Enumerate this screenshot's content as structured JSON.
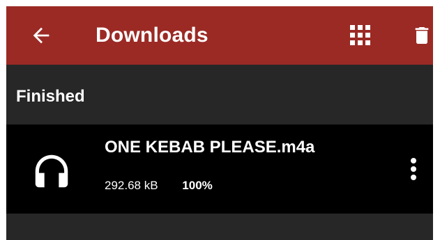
{
  "app_bar": {
    "title": "Downloads",
    "background": "#9b2a25",
    "icons": {
      "back": "arrow-back-icon",
      "grid": "grid-view-icon",
      "delete": "trash-icon"
    }
  },
  "section": {
    "header": "Finished"
  },
  "downloads": [
    {
      "icon": "headphones-icon",
      "filename": "ONE KEBAB PLEASE.m4a",
      "size": "292.68 kB",
      "progress": "100%",
      "menu_icon": "more-vert-icon"
    }
  ]
}
